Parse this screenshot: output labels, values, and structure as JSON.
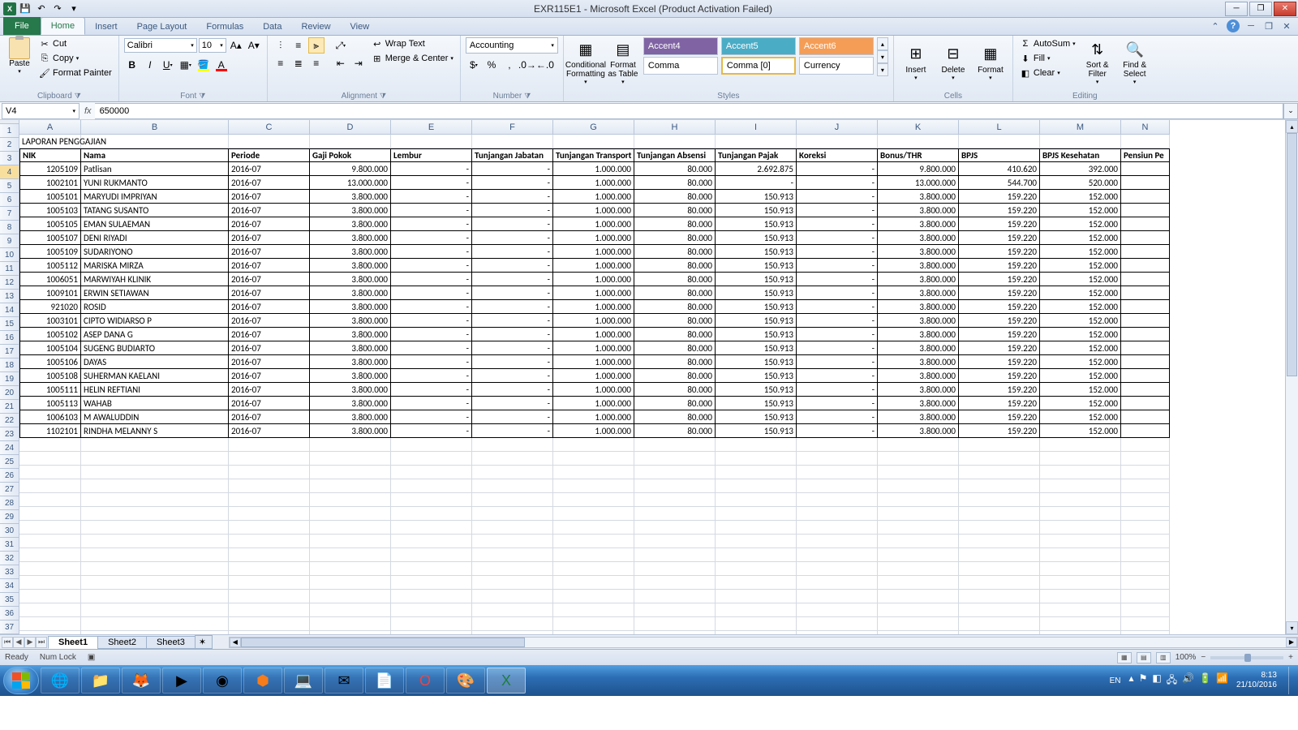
{
  "title": "EXR115E1 - Microsoft Excel (Product Activation Failed)",
  "qat": {
    "save": "💾",
    "undo": "↶",
    "redo": "↷"
  },
  "tabs": {
    "file": "File",
    "home": "Home",
    "insert": "Insert",
    "pageLayout": "Page Layout",
    "formulas": "Formulas",
    "data": "Data",
    "review": "Review",
    "view": "View"
  },
  "ribbon": {
    "clipboard": {
      "paste": "Paste",
      "cut": "Cut",
      "copy": "Copy",
      "formatPainter": "Format Painter",
      "label": "Clipboard"
    },
    "font": {
      "name": "Calibri",
      "size": "10",
      "label": "Font"
    },
    "alignment": {
      "wrap": "Wrap Text",
      "merge": "Merge & Center",
      "label": "Alignment"
    },
    "number": {
      "format": "Accounting",
      "label": "Number"
    },
    "styles": {
      "cond": "Conditional Formatting",
      "table": "Format as Table",
      "a4": "Accent4",
      "a5": "Accent5",
      "a6": "Accent6",
      "comma": "Comma",
      "comma0": "Comma [0]",
      "currency": "Currency",
      "label": "Styles"
    },
    "cells": {
      "insert": "Insert",
      "delete": "Delete",
      "format": "Format",
      "label": "Cells"
    },
    "editing": {
      "autosum": "AutoSum",
      "fill": "Fill",
      "clear": "Clear",
      "sort": "Sort & Filter",
      "find": "Find & Select",
      "label": "Editing"
    }
  },
  "nameBox": "V4",
  "formula": "650000",
  "columns": [
    "A",
    "B",
    "C",
    "D",
    "E",
    "F",
    "G",
    "H",
    "I",
    "J",
    "K",
    "L",
    "M",
    "N"
  ],
  "reportTitle": "LAPORAN PENGGAJIAN",
  "headers": [
    "NIK",
    "Nama",
    "Periode",
    "Gaji Pokok",
    "Lembur",
    "Tunjangan Jabatan",
    "Tunjangan Transport",
    "Tunjangan Absensi",
    "Tunjangan Pajak",
    "Koreksi",
    "Bonus/THR",
    "BPJS",
    "BPJS Kesehatan",
    "Pensiun Pe"
  ],
  "rows": [
    {
      "nik": "1205109",
      "nama": "Patlisan",
      "periode": "2016-07",
      "gaji": "9.800.000",
      "lembur": "-",
      "jab": "-",
      "trans": "1.000.000",
      "abs": "80.000",
      "pajak": "2.692.875",
      "kor": "-",
      "bonus": "9.800.000",
      "bpjs": "410.620",
      "kes": "392.000"
    },
    {
      "nik": "1002101",
      "nama": "YUNI RUKMANTO",
      "periode": "2016-07",
      "gaji": "13.000.000",
      "lembur": "-",
      "jab": "-",
      "trans": "1.000.000",
      "abs": "80.000",
      "pajak": "-",
      "kor": "-",
      "bonus": "13.000.000",
      "bpjs": "544.700",
      "kes": "520.000"
    },
    {
      "nik": "1005101",
      "nama": "MARYUDI IMPRIYAN",
      "periode": "2016-07",
      "gaji": "3.800.000",
      "lembur": "-",
      "jab": "-",
      "trans": "1.000.000",
      "abs": "80.000",
      "pajak": "150.913",
      "kor": "-",
      "bonus": "3.800.000",
      "bpjs": "159.220",
      "kes": "152.000"
    },
    {
      "nik": "1005103",
      "nama": "TATANG SUSANTO",
      "periode": "2016-07",
      "gaji": "3.800.000",
      "lembur": "-",
      "jab": "-",
      "trans": "1.000.000",
      "abs": "80.000",
      "pajak": "150.913",
      "kor": "-",
      "bonus": "3.800.000",
      "bpjs": "159.220",
      "kes": "152.000"
    },
    {
      "nik": "1005105",
      "nama": "EMAN SULAEMAN",
      "periode": "2016-07",
      "gaji": "3.800.000",
      "lembur": "-",
      "jab": "-",
      "trans": "1.000.000",
      "abs": "80.000",
      "pajak": "150.913",
      "kor": "-",
      "bonus": "3.800.000",
      "bpjs": "159.220",
      "kes": "152.000"
    },
    {
      "nik": "1005107",
      "nama": "DENI RIYADI",
      "periode": "2016-07",
      "gaji": "3.800.000",
      "lembur": "-",
      "jab": "-",
      "trans": "1.000.000",
      "abs": "80.000",
      "pajak": "150.913",
      "kor": "-",
      "bonus": "3.800.000",
      "bpjs": "159.220",
      "kes": "152.000"
    },
    {
      "nik": "1005109",
      "nama": "SUDARIYONO",
      "periode": "2016-07",
      "gaji": "3.800.000",
      "lembur": "-",
      "jab": "-",
      "trans": "1.000.000",
      "abs": "80.000",
      "pajak": "150.913",
      "kor": "-",
      "bonus": "3.800.000",
      "bpjs": "159.220",
      "kes": "152.000"
    },
    {
      "nik": "1005112",
      "nama": "MARISKA  MIRZA",
      "periode": "2016-07",
      "gaji": "3.800.000",
      "lembur": "-",
      "jab": "-",
      "trans": "1.000.000",
      "abs": "80.000",
      "pajak": "150.913",
      "kor": "-",
      "bonus": "3.800.000",
      "bpjs": "159.220",
      "kes": "152.000"
    },
    {
      "nik": "1006051",
      "nama": "MARWIYAH KLINIK",
      "periode": "2016-07",
      "gaji": "3.800.000",
      "lembur": "-",
      "jab": "-",
      "trans": "1.000.000",
      "abs": "80.000",
      "pajak": "150.913",
      "kor": "-",
      "bonus": "3.800.000",
      "bpjs": "159.220",
      "kes": "152.000"
    },
    {
      "nik": "1009101",
      "nama": "ERWIN SETIAWAN",
      "periode": "2016-07",
      "gaji": "3.800.000",
      "lembur": "-",
      "jab": "-",
      "trans": "1.000.000",
      "abs": "80.000",
      "pajak": "150.913",
      "kor": "-",
      "bonus": "3.800.000",
      "bpjs": "159.220",
      "kes": "152.000"
    },
    {
      "nik": "921020",
      "nama": "ROSID",
      "periode": "2016-07",
      "gaji": "3.800.000",
      "lembur": "-",
      "jab": "-",
      "trans": "1.000.000",
      "abs": "80.000",
      "pajak": "150.913",
      "kor": "-",
      "bonus": "3.800.000",
      "bpjs": "159.220",
      "kes": "152.000"
    },
    {
      "nik": "1003101",
      "nama": "CIPTO WIDIARSO P",
      "periode": "2016-07",
      "gaji": "3.800.000",
      "lembur": "-",
      "jab": "-",
      "trans": "1.000.000",
      "abs": "80.000",
      "pajak": "150.913",
      "kor": "-",
      "bonus": "3.800.000",
      "bpjs": "159.220",
      "kes": "152.000"
    },
    {
      "nik": "1005102",
      "nama": "ASEP DANA G",
      "periode": "2016-07",
      "gaji": "3.800.000",
      "lembur": "-",
      "jab": "-",
      "trans": "1.000.000",
      "abs": "80.000",
      "pajak": "150.913",
      "kor": "-",
      "bonus": "3.800.000",
      "bpjs": "159.220",
      "kes": "152.000"
    },
    {
      "nik": "1005104",
      "nama": "SUGENG BUDIARTO",
      "periode": "2016-07",
      "gaji": "3.800.000",
      "lembur": "-",
      "jab": "-",
      "trans": "1.000.000",
      "abs": "80.000",
      "pajak": "150.913",
      "kor": "-",
      "bonus": "3.800.000",
      "bpjs": "159.220",
      "kes": "152.000"
    },
    {
      "nik": "1005106",
      "nama": "DAYAS",
      "periode": "2016-07",
      "gaji": "3.800.000",
      "lembur": "-",
      "jab": "-",
      "trans": "1.000.000",
      "abs": "80.000",
      "pajak": "150.913",
      "kor": "-",
      "bonus": "3.800.000",
      "bpjs": "159.220",
      "kes": "152.000"
    },
    {
      "nik": "1005108",
      "nama": "SUHERMAN KAELANI",
      "periode": "2016-07",
      "gaji": "3.800.000",
      "lembur": "-",
      "jab": "-",
      "trans": "1.000.000",
      "abs": "80.000",
      "pajak": "150.913",
      "kor": "-",
      "bonus": "3.800.000",
      "bpjs": "159.220",
      "kes": "152.000"
    },
    {
      "nik": "1005111",
      "nama": "HELIN REFTIANI",
      "periode": "2016-07",
      "gaji": "3.800.000",
      "lembur": "-",
      "jab": "-",
      "trans": "1.000.000",
      "abs": "80.000",
      "pajak": "150.913",
      "kor": "-",
      "bonus": "3.800.000",
      "bpjs": "159.220",
      "kes": "152.000"
    },
    {
      "nik": "1005113",
      "nama": "WAHAB",
      "periode": "2016-07",
      "gaji": "3.800.000",
      "lembur": "-",
      "jab": "-",
      "trans": "1.000.000",
      "abs": "80.000",
      "pajak": "150.913",
      "kor": "-",
      "bonus": "3.800.000",
      "bpjs": "159.220",
      "kes": "152.000"
    },
    {
      "nik": "1006103",
      "nama": "M AWALUDDIN",
      "periode": "2016-07",
      "gaji": "3.800.000",
      "lembur": "-",
      "jab": "-",
      "trans": "1.000.000",
      "abs": "80.000",
      "pajak": "150.913",
      "kor": "-",
      "bonus": "3.800.000",
      "bpjs": "159.220",
      "kes": "152.000"
    },
    {
      "nik": "1102101",
      "nama": "RINDHA MELANNY S",
      "periode": "2016-07",
      "gaji": "3.800.000",
      "lembur": "-",
      "jab": "-",
      "trans": "1.000.000",
      "abs": "80.000",
      "pajak": "150.913",
      "kor": "-",
      "bonus": "3.800.000",
      "bpjs": "159.220",
      "kes": "152.000"
    }
  ],
  "sheets": [
    "Sheet1",
    "Sheet2",
    "Sheet3"
  ],
  "status": {
    "ready": "Ready",
    "numlock": "Num Lock",
    "zoom": "100%"
  },
  "taskbar": {
    "lang": "EN",
    "time": "8:13",
    "date": "21/10/2016"
  }
}
